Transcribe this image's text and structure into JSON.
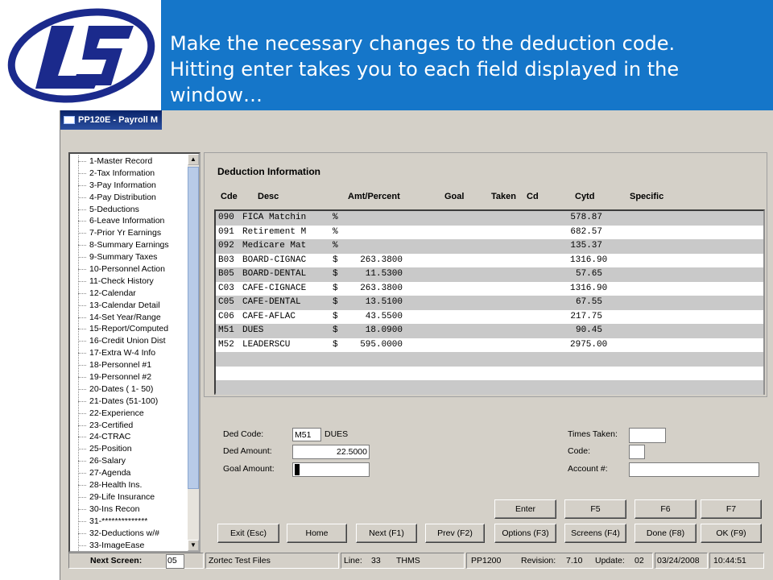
{
  "banner": {
    "line1": "Make the necessary changes to the deduction code.",
    "line2": "Hitting enter takes you to each field displayed in the",
    "line3": "window…"
  },
  "window": {
    "title": "PP120E - Payroll M"
  },
  "tree_items": [
    "1-Master Record",
    "2-Tax Information",
    "3-Pay Information",
    "4-Pay Distribution",
    "5-Deductions",
    "6-Leave Information",
    "7-Prior Yr Earnings",
    "8-Summary Earnings",
    "9-Summary Taxes",
    "10-Personnel Action",
    "11-Check History",
    "12-Calendar",
    "13-Calendar Detail",
    "14-Set Year/Range",
    "15-Report/Computed",
    "16-Credit Union Dist",
    "17-Extra W-4 Info",
    "18-Personnel #1",
    "19-Personnel #2",
    "20-Dates ( 1- 50)",
    "21-Dates (51-100)",
    "22-Experience",
    "23-Certified",
    "24-CTRAC",
    "25-Position",
    "26-Salary",
    "27-Agenda",
    "28-Health Ins.",
    "29-Life Insurance",
    "30-Ins Recon",
    "31-**************",
    "32-Deductions w/#",
    "33-ImageEase"
  ],
  "section_title": "Deduction Information",
  "columns": {
    "cde": "Cde",
    "desc": "Desc",
    "amt": "Amt/Percent",
    "goal": "Goal",
    "taken": "Taken",
    "cd": "Cd",
    "cytd": "Cytd",
    "specific": "Specific"
  },
  "rows": [
    {
      "code": "090",
      "desc": "FICA Matchin",
      "type": "%",
      "amt": "",
      "cytd": "578.87"
    },
    {
      "code": "091",
      "desc": "Retirement M",
      "type": "%",
      "amt": "",
      "cytd": "682.57"
    },
    {
      "code": "092",
      "desc": "Medicare Mat",
      "type": "%",
      "amt": "",
      "cytd": "135.37"
    },
    {
      "code": "B03",
      "desc": "BOARD-CIGNAC",
      "type": "$",
      "amt": "263.3800",
      "cytd": "1316.90"
    },
    {
      "code": "B05",
      "desc": "BOARD-DENTAL",
      "type": "$",
      "amt": "11.5300",
      "cytd": "57.65"
    },
    {
      "code": "C03",
      "desc": "CAFE-CIGNACE",
      "type": "$",
      "amt": "263.3800",
      "cytd": "1316.90"
    },
    {
      "code": "C05",
      "desc": "CAFE-DENTAL",
      "type": "$",
      "amt": "13.5100",
      "cytd": "67.55"
    },
    {
      "code": "C06",
      "desc": "CAFE-AFLAC",
      "type": "$",
      "amt": "43.5500",
      "cytd": "217.75"
    },
    {
      "code": "M51",
      "desc": "DUES",
      "type": "$",
      "amt": "18.0900",
      "cytd": "90.45"
    },
    {
      "code": "M52",
      "desc": "LEADERSCU",
      "type": "$",
      "amt": "595.0000",
      "cytd": "2975.00"
    },
    {
      "code": "",
      "desc": "",
      "type": "",
      "amt": "",
      "cytd": ""
    },
    {
      "code": "",
      "desc": "",
      "type": "",
      "amt": "",
      "cytd": ""
    },
    {
      "code": "",
      "desc": "",
      "type": "",
      "amt": "",
      "cytd": ""
    }
  ],
  "form": {
    "ded_code_label": "Ded Code:",
    "ded_code_value": "M51",
    "ded_code_desc": "DUES",
    "ded_amount_label": "Ded Amount:",
    "ded_amount_value": "22.5000",
    "goal_amount_label": "Goal Amount:",
    "goal_amount_value": "",
    "times_taken_label": "Times Taken:",
    "times_taken_value": "",
    "code_label": "Code:",
    "code_value": "",
    "account_label": "Account #:",
    "account_value": ""
  },
  "buttons": {
    "enter": "Enter",
    "f5": "F5",
    "f6": "F6",
    "f7": "F7",
    "exit": "Exit (Esc)",
    "home": "Home",
    "next": "Next (F1)",
    "prev": "Prev (F2)",
    "options": "Options (F3)",
    "screens": "Screens (F4)",
    "done": "Done (F8)",
    "ok": "OK (F9)"
  },
  "status": {
    "next_screen_label": "Next Screen:",
    "next_screen_value": "05",
    "db_name": "Zortec Test Files",
    "line_label": "Line:",
    "line_value": "33",
    "user": "THMS",
    "program": "PP1200",
    "revision_label": "Revision:",
    "revision_value": "7.10",
    "update_label": "Update:",
    "update_value": "02",
    "date": "03/24/2008",
    "time": "10:44:51"
  },
  "colors": {
    "banner": "#1576c9",
    "logo": "#1b2a8c",
    "alt_row": "#c9c9c9"
  }
}
